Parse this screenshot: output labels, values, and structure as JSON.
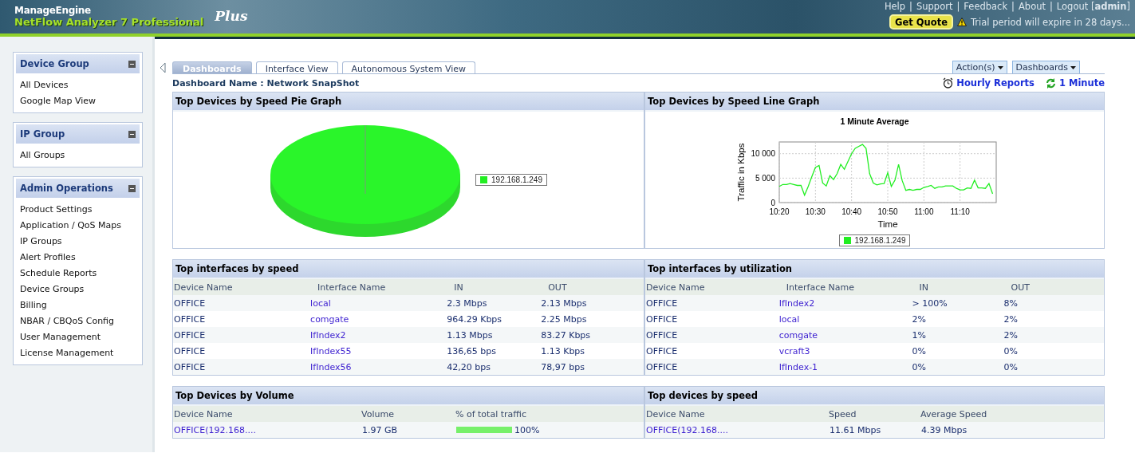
{
  "header": {
    "company": "ManageEngine",
    "product": "NetFlow Analyzer 7 Professional",
    "edition": "Plus",
    "top_links": [
      "Help",
      "Support",
      "Feedback",
      "About",
      "Logout [**admin**]"
    ],
    "link_separator": "|",
    "quote_button": "Get Quote",
    "trial_notice": "Trial period will expire in 28 days..."
  },
  "sidebar": {
    "panels": [
      {
        "title": "Device Group",
        "items": [
          "All Devices",
          "Google Map View"
        ]
      },
      {
        "title": "IP Group",
        "items": [
          "All Groups"
        ]
      },
      {
        "title": "Admin Operations",
        "items": [
          "Product Settings",
          "Application / QoS Maps",
          "IP Groups",
          "Alert Profiles",
          "Schedule Reports",
          "Device Groups",
          "Billing",
          "NBAR / CBQoS Config",
          "User Management",
          "License Management"
        ]
      }
    ]
  },
  "tabs": [
    {
      "label": "Dashboards",
      "selected": true
    },
    {
      "label": "Interface View",
      "selected": false
    },
    {
      "label": "Autonomous System View",
      "selected": false
    }
  ],
  "menus": [
    "Action(s)",
    "Dashboards"
  ],
  "dashboard_name": "Dashboard Name : Network SnapShot",
  "links": [
    {
      "kind": "report",
      "label": "Hourly Reports"
    },
    {
      "kind": "refresh",
      "label": "1 Minute"
    }
  ],
  "widgets": [
    {
      "kind": "pie",
      "title": "Top Devices by Speed Pie Graph",
      "legend": [
        {
          "label": "192.168.1.249",
          "color": "#22ee22"
        }
      ]
    },
    {
      "kind": "line",
      "title": "Top Devices by Speed Line Graph",
      "chart_data": {
        "type": "line",
        "title": "1 Minute Average",
        "xlabel": "Time",
        "ylabel": "Traffic in Kbps",
        "categories": [
          "10:20",
          null,
          null,
          null,
          null,
          null,
          null,
          null,
          null,
          null,
          "10:30",
          null,
          null,
          null,
          null,
          null,
          null,
          null,
          null,
          null,
          "10:40",
          null,
          null,
          null,
          null,
          null,
          null,
          null,
          null,
          null,
          "10:50",
          null,
          null,
          null,
          null,
          null,
          null,
          null,
          null,
          null,
          "11:00",
          null,
          null,
          null,
          null,
          null,
          null,
          null,
          null,
          null,
          "11:10",
          null,
          null,
          null,
          null,
          null,
          null,
          null,
          null,
          null
        ],
        "series": [
          {
            "name": "192.168.1.249",
            "color": "#22ee22",
            "values": [
              3300,
              3700,
              3700,
              3900,
              3700,
              3500,
              3500,
              1500,
              3300,
              5300,
              7200,
              7600,
              4000,
              3400,
              5500,
              4700,
              5900,
              7800,
              6800,
              8400,
              10000,
              11100,
              11500,
              11900,
              11100,
              5900,
              4000,
              3600,
              3800,
              3900,
              6100,
              3300,
              4600,
              7800,
              4500,
              2500,
              2700,
              2500,
              2700,
              2700,
              3100,
              3300,
              3500,
              2900,
              3200,
              3200,
              3400,
              3400,
              3400,
              2900,
              2600,
              2600,
              3000,
              2900,
              4600,
              3000,
              3000,
              2900,
              3900,
              1800
            ]
          }
        ],
        "grid": true,
        "ylim": [
          0,
          12400
        ],
        "yticks": [
          {
            "value": 0,
            "label": "0"
          },
          {
            "value": 5000,
            "label": "5 000"
          },
          {
            "value": 10000,
            "label": "10 000"
          }
        ]
      }
    },
    {
      "kind": "table",
      "title": "Top interfaces by speed",
      "columns": [
        {
          "label": "Device Name",
          "kind": "device"
        },
        {
          "label": "Interface Name",
          "kind": "link"
        },
        {
          "label": "IN",
          "kind": "value"
        },
        {
          "label": "OUT",
          "kind": "value"
        }
      ],
      "rows": [
        [
          "OFFICE",
          "local",
          "2.3 Mbps",
          "2.13 Mbps"
        ],
        [
          "OFFICE",
          "comgate",
          "964.29 Kbps",
          "2.25 Mbps"
        ],
        [
          "OFFICE",
          "IfIndex2",
          "1.13 Mbps",
          "83.27 Kbps"
        ],
        [
          "OFFICE",
          "IfIndex55",
          "136,65 bps",
          "1.13 Kbps"
        ],
        [
          "OFFICE",
          "IfIndex56",
          "42,20 bps",
          "78,97 bps"
        ]
      ]
    },
    {
      "kind": "table",
      "title": "Top interfaces by utilization",
      "columns": [
        {
          "label": "Device Name",
          "kind": "device"
        },
        {
          "label": "Interface Name",
          "kind": "link"
        },
        {
          "label": "IN",
          "kind": "value"
        },
        {
          "label": "OUT",
          "kind": "value"
        }
      ],
      "rows": [
        [
          "OFFICE",
          "IfIndex2",
          "> 100%",
          "8%"
        ],
        [
          "OFFICE",
          "local",
          "2%",
          "2%"
        ],
        [
          "OFFICE",
          "comgate",
          "1%",
          "2%"
        ],
        [
          "OFFICE",
          "vcraft3",
          "0%",
          "0%"
        ],
        [
          "OFFICE",
          "IfIndex-1",
          "0%",
          "0%"
        ]
      ]
    },
    {
      "kind": "table",
      "title": "Top Devices by Volume",
      "columns": [
        {
          "label": "Device Name",
          "kind": "link"
        },
        {
          "label": "Volume",
          "kind": "value"
        },
        {
          "label": "% of total traffic",
          "kind": "bar"
        }
      ],
      "rows": [
        [
          "OFFICE(192.168....",
          "1.97 GB",
          {
            "text": "100%",
            "level": 1
          }
        ]
      ]
    },
    {
      "kind": "table",
      "title": "Top devices by speed",
      "columns": [
        {
          "label": "Device Name",
          "kind": "link"
        },
        {
          "label": "Speed",
          "kind": "value"
        },
        {
          "label": "Average Speed",
          "kind": "value"
        }
      ],
      "rows": [
        [
          "OFFICE(192.168....",
          "11.61 Mbps",
          "4.39 Mbps"
        ]
      ]
    }
  ]
}
